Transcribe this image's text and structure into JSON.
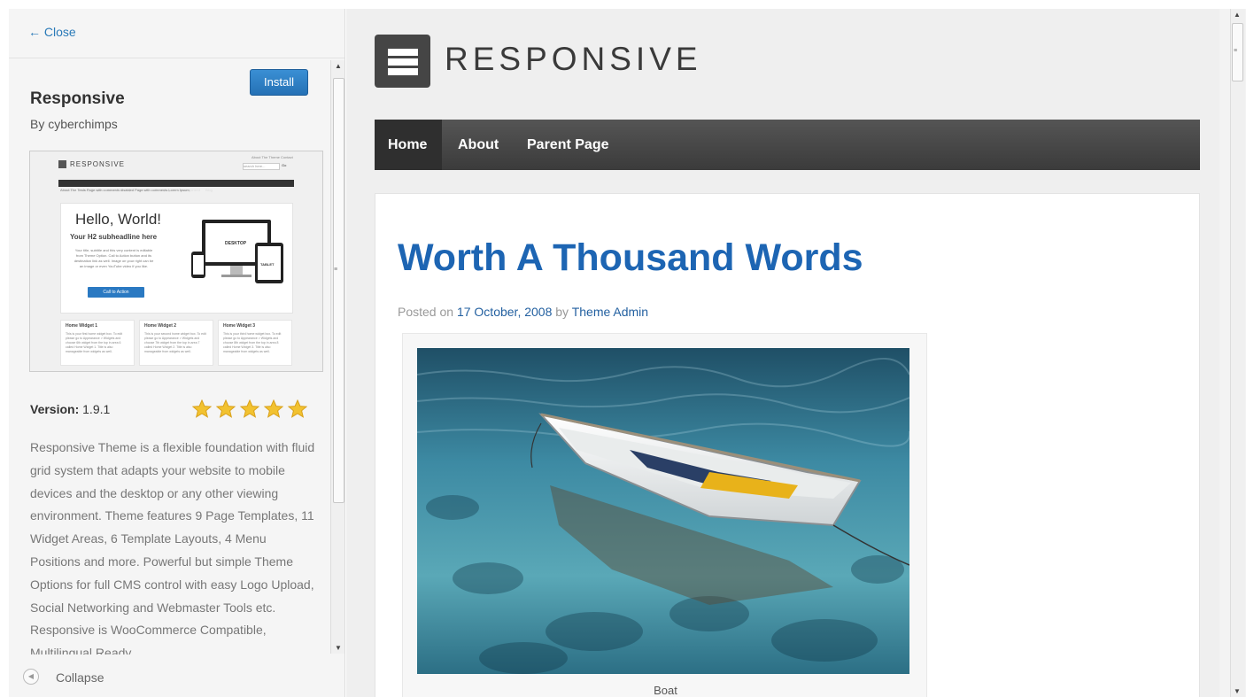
{
  "sidebar": {
    "close_label": "← Close",
    "install_label": "Install",
    "theme_name": "Responsive",
    "theme_author": "By cyberchimps",
    "version_label": "Version:",
    "version_value": "1.9.1",
    "rating_stars": 5,
    "description": "Responsive Theme is a flexible foundation with fluid grid system that adapts your website to mobile devices and the desktop or any other viewing environment. Theme features 9 Page Templates, 11 Widget Areas, 6 Template Layouts, 4 Menu Positions and more. Powerful but simple Theme Options for full CMS control with easy Logo Upload, Social Networking and Webmaster Tools etc. Responsive is WooCommerce Compatible, Multilingual Ready",
    "collapse_label": "Collapse",
    "thumbnail": {
      "logo": "RESPONSIVE",
      "top_links": "About The Theme   Contact",
      "search_placeholder": "search here...",
      "search_go": "Go",
      "nav_items": [
        "Home",
        "Visiting People",
        "About The Guys",
        "Level 1",
        "Front page",
        "Uncategorized",
        "Blog"
      ],
      "sub_nav": "About The Tests    Page with comments disabled    Page with comments    Lorem Ipsum",
      "hero_title": "Hello, World!",
      "hero_subtitle": "Your H2 subheadline here",
      "hero_text": "Your title, subtitle and this very content is editable from Theme Option. Call to Action button and its destination link as well. Image on your right can be an image or even YouTube video if you like.",
      "cta": "Call to Action",
      "desktop_label": "DESKTOP",
      "tablet_label": "TABLET",
      "widgets": [
        {
          "title": "Home Widget 1",
          "text": "This is your first home widget box. To edit please go to Appearance > Widgets and choose 6th widget from the top in area 6 called Home Widget 1. Title is also manageable from widgets as well."
        },
        {
          "title": "Home Widget 2",
          "text": "This is your second home widget box. To edit please go to Appearance > Widgets and choose 7th widget from the top in area 7 called Home Widget 2. Title is also manageable from widgets as well."
        },
        {
          "title": "Home Widget 3",
          "text": "This is your third home widget box. To edit please go to Appearance > Widgets and choose 8th widget from the top in area 8 called Home Widget 3. Title is also manageable from widgets as well."
        }
      ]
    }
  },
  "preview": {
    "site_logo": "RESPONSIVE",
    "nav": [
      "Home",
      "About",
      "Parent Page"
    ],
    "active_nav": "Home",
    "post_title": "Worth A Thousand Words",
    "posted_on": "Posted on",
    "post_date": "17 October, 2008",
    "by": "by",
    "author": "Theme Admin",
    "image_caption": "Boat"
  },
  "colors": {
    "link": "#2a7ab8",
    "install_button": "#2d7dc3",
    "post_title": "#1d65b3",
    "nav_bg": "#474747",
    "star": "#f2c230"
  },
  "icons": {
    "close": "left-arrow-icon",
    "collapse": "collapse-circle-icon",
    "rating": "star-icon",
    "logo": "menu-bars-icon"
  }
}
